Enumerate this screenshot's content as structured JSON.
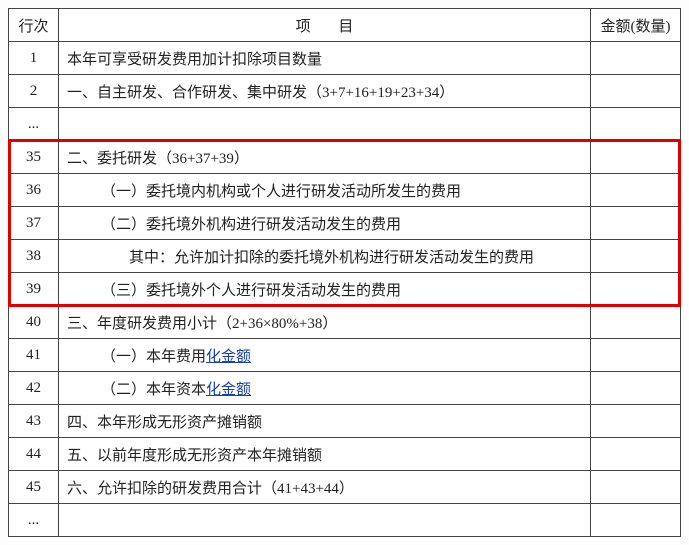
{
  "headers": {
    "row": "行次",
    "item": "项 目",
    "amount": "金额(数量)"
  },
  "ellipsis": "...",
  "rows": {
    "r1": {
      "num": "1",
      "text_a": "本年可享受研发费用加计扣除项目数量"
    },
    "r2": {
      "num": "2",
      "text_a": "一、自主研发、合作研发、集中研发（3+7+16+19+23+34）"
    },
    "r35": {
      "num": "35",
      "text_a": "二、委托研发（36+37+39）"
    },
    "r36": {
      "num": "36",
      "text_a": "（一）委托境内机构或个人进行研发活动所发生的费用"
    },
    "r37": {
      "num": "37",
      "text_a": "（二）委托境外机构进行研发活动发生的费用"
    },
    "r38": {
      "num": "38",
      "text_a": "其中：允许加计扣除的委托境外机构进行研发活动发生的费用"
    },
    "r39": {
      "num": "39",
      "text_a": "（三）委托境外个人进行研发活动发生的费用"
    },
    "r40": {
      "num": "40",
      "text_a": "三、年度研发费用小计（2+36×80%+38）"
    },
    "r41": {
      "num": "41",
      "text_a": "（一）本年费用",
      "link": "化金额"
    },
    "r42": {
      "num": "42",
      "text_a": "（二）本年资本",
      "link": "化金额"
    },
    "r43": {
      "num": "43",
      "text_a": "四、本年形成无形资产摊销额"
    },
    "r44": {
      "num": "44",
      "text_a": "五、以前年度形成无形资产本年摊销额"
    },
    "r45": {
      "num": "45",
      "text_a": "六、允许扣除的研发费用合计（41+43+44）"
    }
  }
}
